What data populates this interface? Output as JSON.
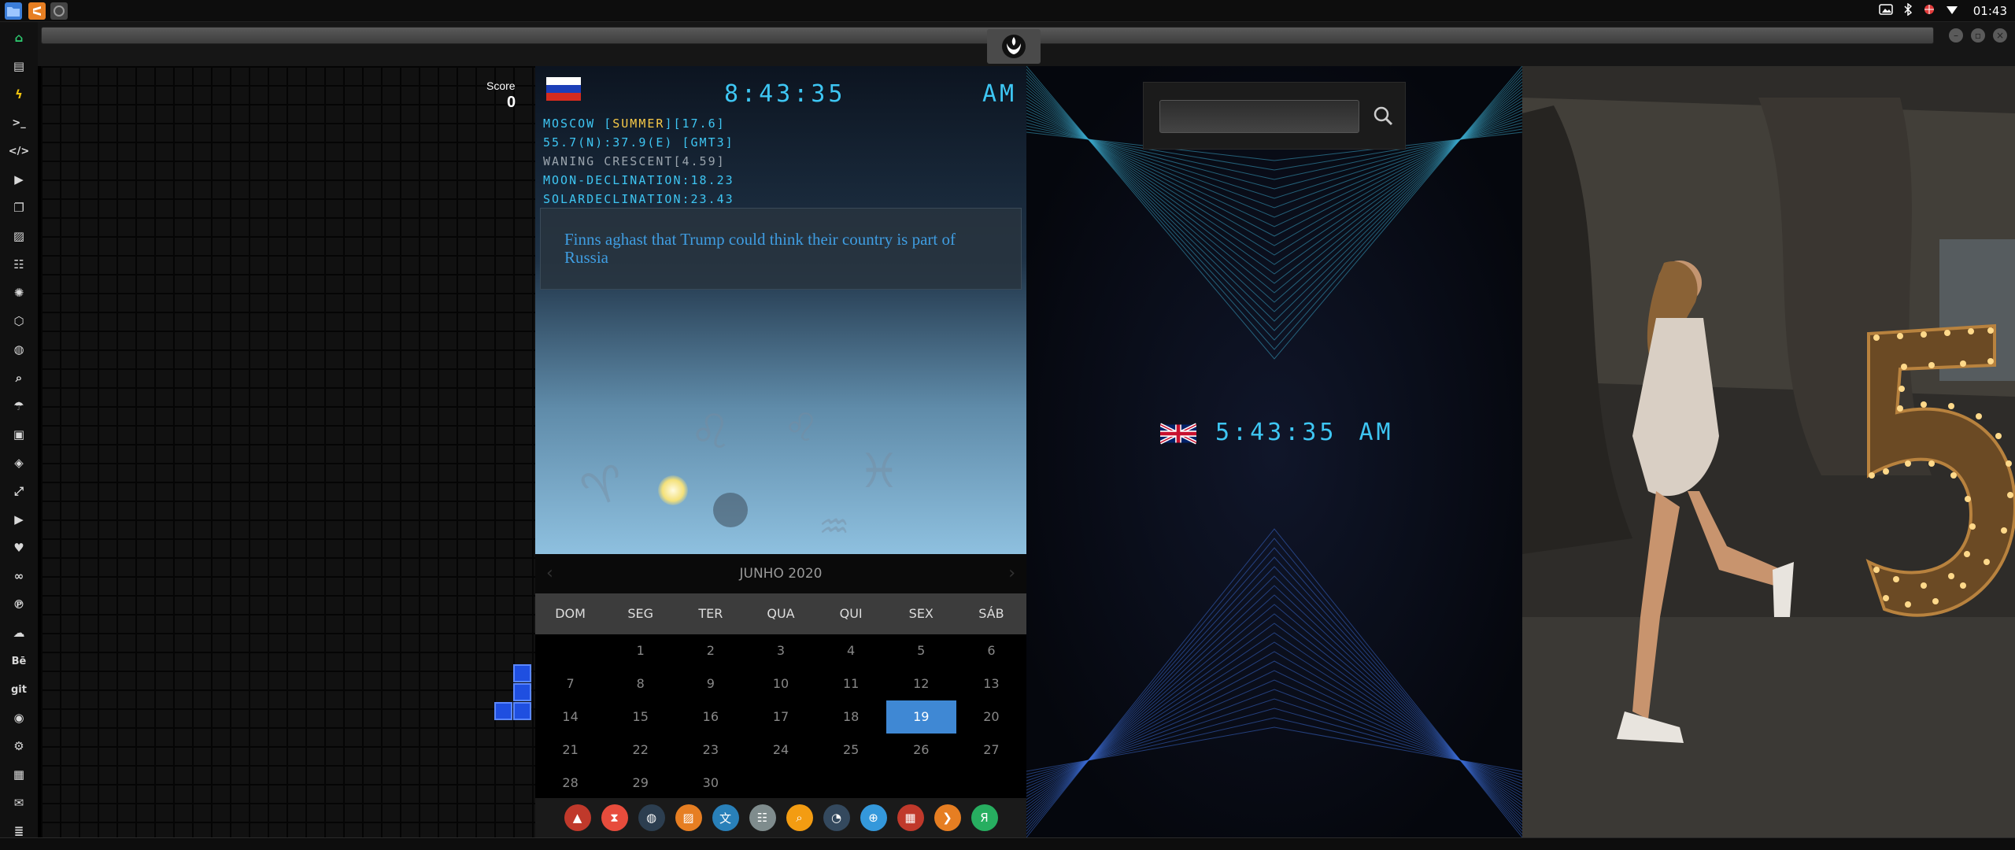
{
  "topbar": {
    "left_icons": [
      "folder-icon",
      "sublime-icon",
      "circle-app-icon"
    ],
    "tray_icons": [
      "screenshot-icon",
      "bluetooth-icon",
      "bug-icon",
      "wifi-icon"
    ],
    "time": "01:43"
  },
  "window": {
    "controls": [
      "minimize",
      "maximize",
      "close"
    ],
    "emblem": "rebel-alliance-icon"
  },
  "sidebar": {
    "items": [
      {
        "icon": "home-icon",
        "label": "",
        "color": "#2ecc71"
      },
      {
        "icon": "document-icon",
        "label": ""
      },
      {
        "icon": "lightning-icon",
        "label": "",
        "color": "#f1c40f"
      },
      {
        "icon": "terminal-icon",
        "label": ">_"
      },
      {
        "icon": "code-icon",
        "label": "</>"
      },
      {
        "icon": "play-icon",
        "label": ""
      },
      {
        "icon": "files-icon",
        "label": ""
      },
      {
        "icon": "image-icon",
        "label": ""
      },
      {
        "icon": "news-icon",
        "label": ""
      },
      {
        "icon": "settings-icon",
        "label": ""
      },
      {
        "icon": "hexagon-icon",
        "label": ""
      },
      {
        "icon": "globe-icon",
        "label": ""
      },
      {
        "icon": "search-icon",
        "label": ""
      },
      {
        "icon": "umbrella-icon",
        "label": ""
      },
      {
        "icon": "contact-icon",
        "label": ""
      },
      {
        "icon": "tag-icon",
        "label": ""
      },
      {
        "icon": "expand-icon",
        "label": ""
      },
      {
        "icon": "youtube-icon",
        "label": ""
      },
      {
        "icon": "heart-icon",
        "label": ""
      },
      {
        "icon": "infinity-icon",
        "label": ""
      },
      {
        "icon": "pinterest-icon",
        "label": ""
      },
      {
        "icon": "cloud-icon",
        "label": ""
      },
      {
        "icon": "behance-icon",
        "label": "Bē"
      },
      {
        "icon": "git-icon",
        "label": "git"
      },
      {
        "icon": "github-icon",
        "label": ""
      },
      {
        "icon": "bicycle-icon",
        "label": ""
      },
      {
        "icon": "map-icon",
        "label": ""
      },
      {
        "icon": "mail-icon",
        "label": ""
      },
      {
        "icon": "server-icon",
        "label": ""
      }
    ]
  },
  "tetris": {
    "score_label": "Score",
    "score_value": "0"
  },
  "moscow": {
    "flag": "russia-flag-icon",
    "time": "8:43:35",
    "ampm": "AM",
    "line1_prefix": "MOSCOW [",
    "line1_season": "SUMMER",
    "line1_suffix": "][17.6]",
    "line2": "55.7(N):37.9(E) [GMT3]",
    "line3": "WANING CRESCENT[4.59]",
    "line4": "MOON-DECLINATION:18.23",
    "line5": "SOLARDECLINATION:23.43",
    "news": "Finns aghast that Trump could think their country is part of Russia",
    "zodiac": [
      "♌",
      "♈",
      "♓",
      "♒"
    ]
  },
  "calendar": {
    "month_label": "JUNHO 2020",
    "weekdays": [
      "DOM",
      "SEG",
      "TER",
      "QUA",
      "QUI",
      "SEX",
      "SÁB"
    ],
    "weeks": [
      [
        "",
        "1",
        "2",
        "3",
        "4",
        "5",
        "6"
      ],
      [
        "7",
        "8",
        "9",
        "10",
        "11",
        "12",
        "13"
      ],
      [
        "14",
        "15",
        "16",
        "17",
        "18",
        "19",
        "20"
      ],
      [
        "21",
        "22",
        "23",
        "24",
        "25",
        "26",
        "27"
      ],
      [
        "28",
        "29",
        "30",
        "",
        "",
        "",
        ""
      ]
    ],
    "today": "19"
  },
  "dock": {
    "items": [
      {
        "icon": "app-launcher-icon",
        "color": "#c0392b"
      },
      {
        "icon": "hourglass-icon",
        "color": "#e74c3c"
      },
      {
        "icon": "globe-dark-icon",
        "color": "#2c3e50"
      },
      {
        "icon": "image-viewer-icon",
        "color": "#e67e22"
      },
      {
        "icon": "translate-icon",
        "color": "#2980b9"
      },
      {
        "icon": "newspaper-icon",
        "color": "#7f8c8d"
      },
      {
        "icon": "search-orange-icon",
        "color": "#f39c12"
      },
      {
        "icon": "clock-icon",
        "color": "#34495e"
      },
      {
        "icon": "web-icon",
        "color": "#3498db"
      },
      {
        "icon": "calendar-icon",
        "color": "#c0392b"
      },
      {
        "icon": "arrow-icon",
        "color": "#e67e22"
      },
      {
        "icon": "yandex-icon",
        "color": "#27ae60"
      }
    ]
  },
  "uk": {
    "flag": "uk-flag-icon",
    "time": "5:43:35",
    "ampm": "AM",
    "search_placeholder": ""
  },
  "colors": {
    "accent_cyan": "#3ec6f3",
    "highlight_yellow": "#f7c948",
    "calendar_today": "#3f88d4",
    "tetris_block": "#1f4fe0"
  }
}
